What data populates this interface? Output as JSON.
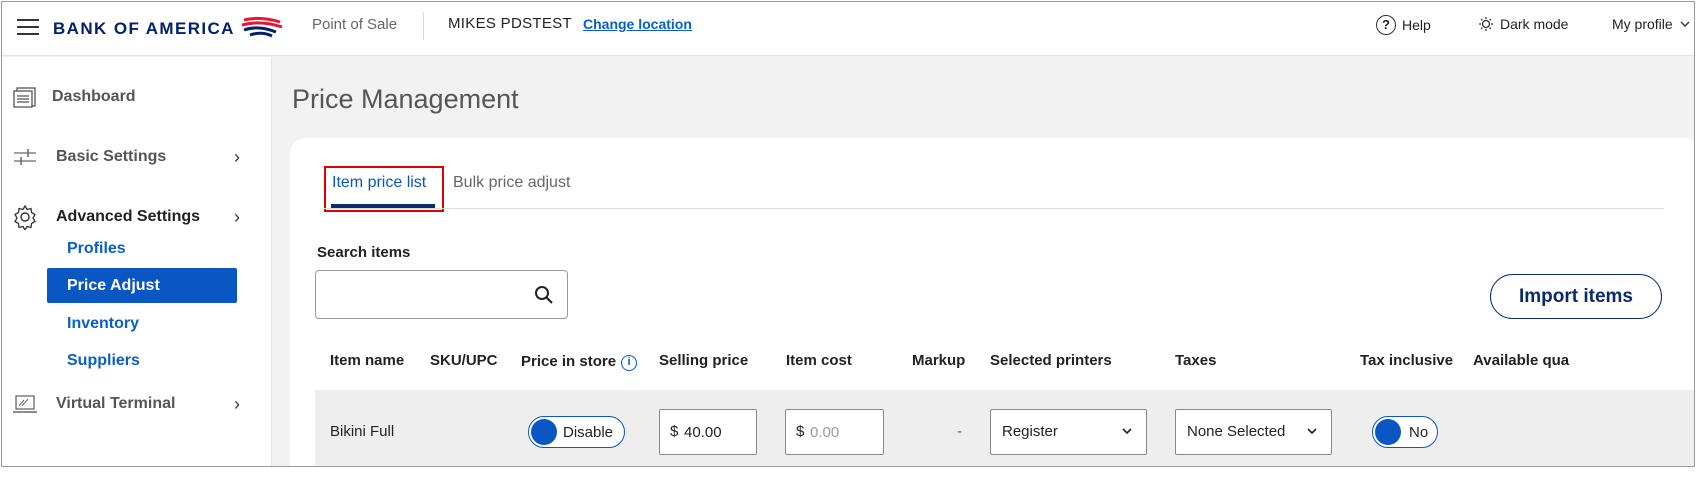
{
  "header": {
    "logo_text": "BANK OF AMERICA",
    "app_name": "Point of Sale",
    "location": "MIKES PDSTEST",
    "change_location": "Change location",
    "help": "Help",
    "dark_mode": "Dark mode",
    "my_profile": "My profile"
  },
  "sidebar": {
    "items": [
      {
        "label": "Dashboard",
        "icon": "dashboard-icon"
      },
      {
        "label": "Basic Settings",
        "icon": "sliders-icon"
      },
      {
        "label": "Advanced Settings",
        "icon": "gear-icon"
      },
      {
        "label": "Virtual Terminal",
        "icon": "laptop-icon"
      }
    ],
    "sub_items": [
      "Profiles",
      "Price Adjust",
      "Inventory",
      "Suppliers"
    ],
    "active_sub_item": "Price Adjust"
  },
  "main": {
    "title": "Price Management",
    "tabs": [
      {
        "label": "Item price list",
        "active": true
      },
      {
        "label": "Bulk price adjust",
        "active": false
      }
    ],
    "search": {
      "label": "Search items",
      "value": ""
    },
    "import_button": "Import items",
    "columns": [
      "Item name",
      "SKU/UPC",
      "Price in store",
      "Selling price",
      "Item cost",
      "Markup",
      "Selected printers",
      "Taxes",
      "Tax inclusive",
      "Available qua"
    ],
    "rows": [
      {
        "item_name": "Bikini Full",
        "sku_upc": "",
        "price_in_store": "Disable",
        "currency_symbol": "$",
        "selling_price": "40.00",
        "item_cost_placeholder": "0.00",
        "markup": "-",
        "selected_printers": "Register",
        "taxes": "None Selected",
        "tax_inclusive": "No"
      }
    ]
  },
  "colors": {
    "brand_navy": "#012169",
    "brand_red": "#e31837",
    "accent_blue": "#0a56c2",
    "highlight_box": "#e00000"
  }
}
